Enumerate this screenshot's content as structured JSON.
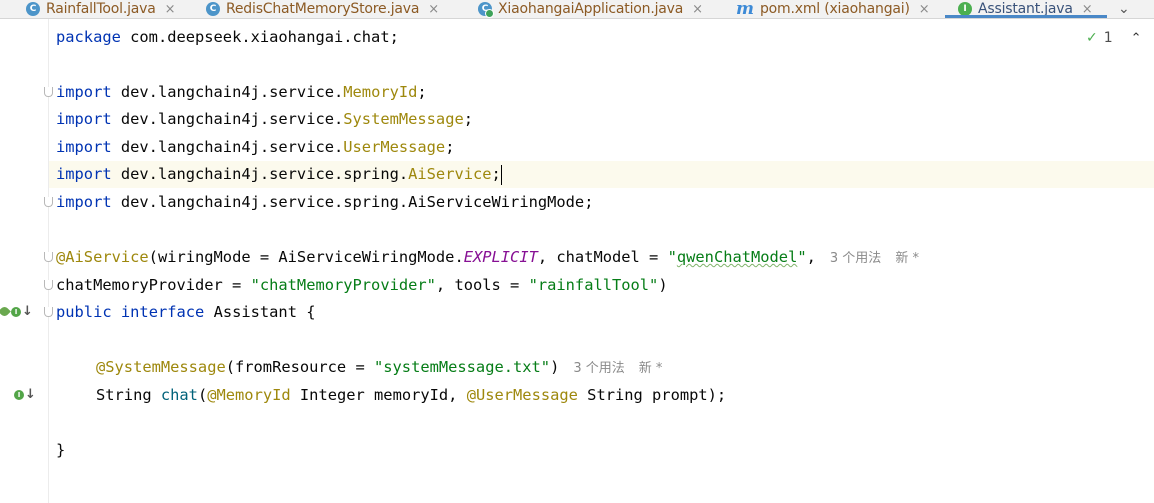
{
  "tabs": [
    {
      "label": "RainfallTool.java",
      "icon": "class-icon",
      "close": "×"
    },
    {
      "label": "RedisChatMemoryStore.java",
      "icon": "class-icon",
      "close": "×"
    },
    {
      "label": "XiaohangaiApplication.java",
      "icon": "spring-class-icon",
      "close": "×"
    },
    {
      "label": "pom.xml (xiaohangai)",
      "icon": "maven-icon",
      "close": "×"
    },
    {
      "label": "Assistant.java",
      "icon": "interface-icon",
      "close": "×",
      "active": true
    }
  ],
  "tab_overflow": "⌄",
  "inspection": {
    "count": "1",
    "check": "✓",
    "chevron": "⌃"
  },
  "code": {
    "line1": {
      "kw": "package",
      "rest": " com.deepseek.xiaohangai.chat;"
    },
    "imports": [
      {
        "kw": "import",
        "pkg": " dev.langchain4j.service.",
        "cls": "MemoryId",
        "end": ";"
      },
      {
        "kw": "import",
        "pkg": " dev.langchain4j.service.",
        "cls": "SystemMessage",
        "end": ";"
      },
      {
        "kw": "import",
        "pkg": " dev.langchain4j.service.",
        "cls": "UserMessage",
        "end": ";"
      },
      {
        "kw": "import",
        "pkg": " dev.langchain4j.service.spring.",
        "cls": "AiService",
        "end": ";"
      },
      {
        "kw": "import",
        "pkg": " dev.langchain4j.service.spring.",
        "cls": "AiServiceWiringMode",
        "end": ";"
      }
    ],
    "annotation_line1": {
      "ann": "@AiService",
      "p1": "(wiringMode = AiServiceWiringMode.",
      "const": "EXPLICIT",
      "p2": ", chatModel = ",
      "str_open": "\"",
      "str_body": "qwenChatModel",
      "str_close": "\"",
      "p3": ",",
      "hint_usages": "3 个用法",
      "hint_new": "新 *"
    },
    "annotation_line2": {
      "p1": "chatMemoryProvider = ",
      "str1": "\"chatMemoryProvider\"",
      "p2": ", tools = ",
      "str2": "\"rainfallTool\"",
      "p3": ")"
    },
    "interface_line": {
      "kw1": "public",
      "kw2": "interface",
      "rest": " Assistant {"
    },
    "method_ann": {
      "ann": "@SystemMessage",
      "p1": "(fromResource = ",
      "str": "\"systemMessage.txt\"",
      "p2": ")",
      "hint_usages": "3 个用法",
      "hint_new": "新 *"
    },
    "method_line": {
      "p1": "String ",
      "name": "chat",
      "p2": "(",
      "ann1": "@MemoryId",
      "p3": " Integer memoryId, ",
      "ann2": "@UserMessage",
      "p4": " String prompt);"
    },
    "closing": "}"
  },
  "colors": {
    "keyword": "#0033b3",
    "annotation": "#9e880d",
    "string": "#067d17",
    "constant": "#871094"
  }
}
